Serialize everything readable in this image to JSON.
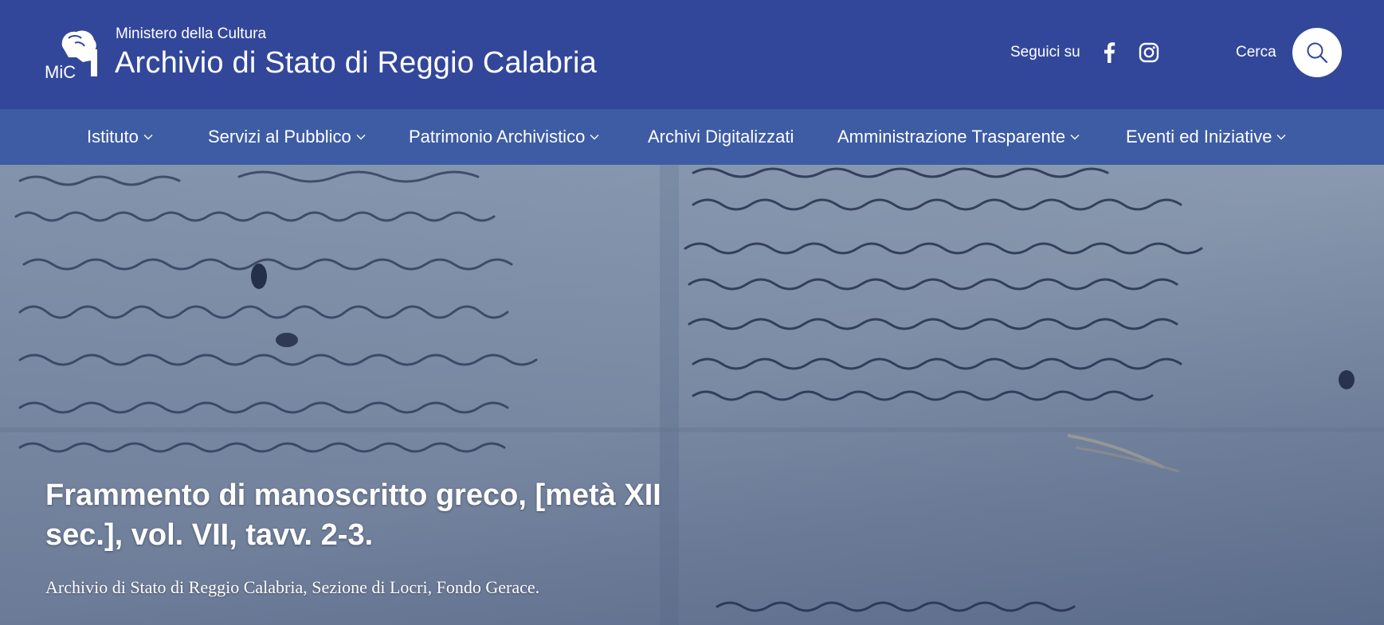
{
  "header": {
    "logo_text": "MiC",
    "ministry": "Ministero della Cultura",
    "site_title": "Archivio di Stato di Reggio Calabria",
    "social_label": "Seguici su",
    "social_icons": [
      "facebook-icon",
      "instagram-icon"
    ],
    "search_label": "Cerca",
    "search_icon": "search-icon"
  },
  "nav": {
    "items": [
      {
        "label": "Istituto",
        "dropdown": true
      },
      {
        "label": "Servizi al Pubblico",
        "dropdown": true
      },
      {
        "label": "Patrimonio Archivistico",
        "dropdown": true
      },
      {
        "label": "Archivi Digitalizzati",
        "dropdown": false
      },
      {
        "label": "Amministrazione Trasparente",
        "dropdown": true
      },
      {
        "label": "Eventi ed Iniziative",
        "dropdown": true
      }
    ]
  },
  "hero": {
    "title": "Frammento di manoscritto greco, [metà XII sec.], vol. VII, tavv. 2-3.",
    "subtitle": "Archivio di Stato di Reggio Calabria, Sezione di Locri, Fondo Gerace."
  },
  "colors": {
    "header_bg": "#32479a",
    "nav_bg": "#3d5ca4",
    "text": "#ffffff"
  }
}
